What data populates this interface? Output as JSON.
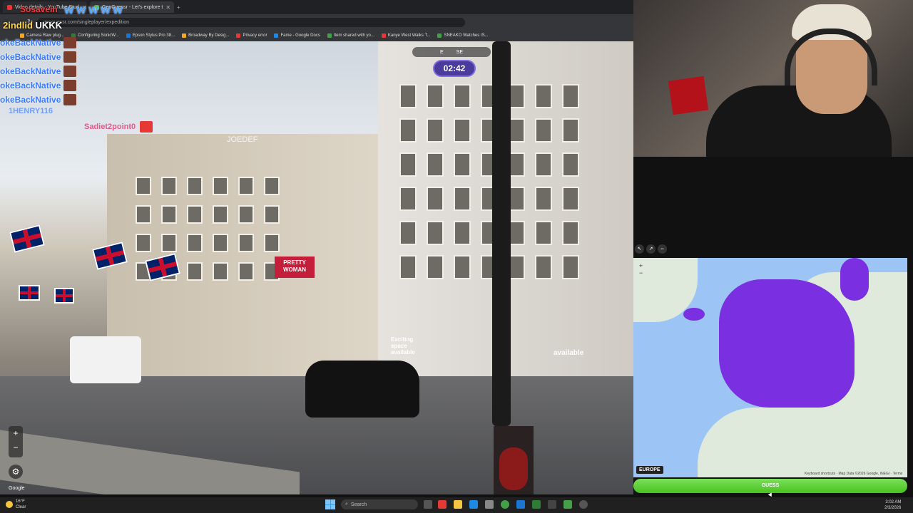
{
  "browser": {
    "tabs": [
      {
        "title": "Video details - YouTube Stud",
        "active": false
      },
      {
        "title": "GeoGuessr - Let's explore t",
        "active": true
      }
    ],
    "new_tab": "+",
    "url": "geoguessr.com/singleplayer/expedition",
    "bookmarks": [
      "Camera Raw plug...",
      "Configuring SonicW...",
      "Epson Stylus Pro 38...",
      "Broadway By Desig...",
      "Privacy error",
      "Fame - Google Docs",
      "Item shared with yo...",
      "Kanye West Walks T...",
      "SNEAKO Watches IS..."
    ]
  },
  "game": {
    "compass_labels": [
      "E",
      "SE"
    ],
    "timer": "02:42",
    "street_watermark": "JOEDEF",
    "shop_sign": "PRETTY WOMAN",
    "store_text_1": "Exciting space available",
    "store_text_2": "available",
    "zoom_in": "+",
    "zoom_out": "−",
    "settings_icon": "⚙",
    "google_label": "Google"
  },
  "chat": {
    "header": "2indlid",
    "header_text": "UKKK",
    "overlay_top": "Sosavein",
    "overlay_wave": "W W W W W",
    "lines": [
      "okeBackNative",
      "okeBackNative",
      "okeBackNative",
      "okeBackNative",
      "okeBackNative"
    ],
    "user_henry": "1HENRY116",
    "user_sadie": "Sadiet2point0"
  },
  "map": {
    "tools": [
      "↖",
      "↗",
      "⇔"
    ],
    "zoom_in": "+",
    "zoom_out": "−",
    "region_label": "EUROPE",
    "attribution": "Keyboard shortcuts · Map Data ©2026 Google, INEGI · Terms",
    "guess_button": "GUESS",
    "highlight_color": "#7a2fe0"
  },
  "taskbar": {
    "weather_temp": "16°F",
    "weather_text": "Clear",
    "search_placeholder": "Search",
    "time": "3:02 AM",
    "date": "2/3/2026"
  }
}
